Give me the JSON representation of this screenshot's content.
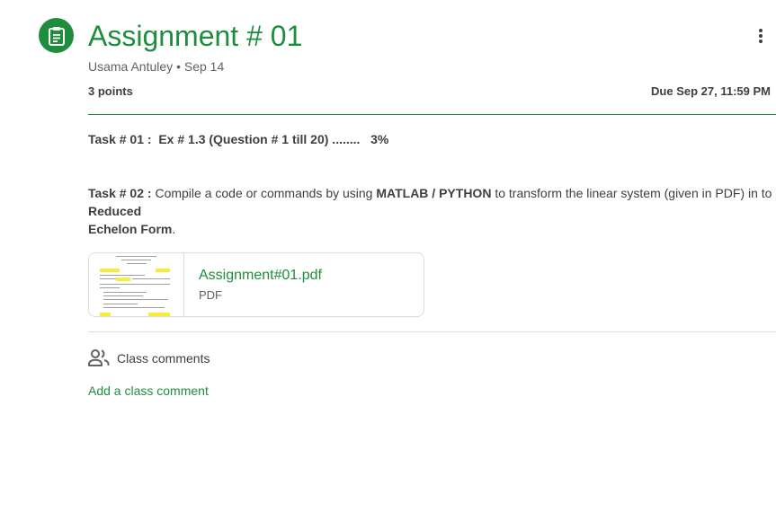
{
  "header": {
    "title": "Assignment # 01",
    "author": "Usama Antuley",
    "separator": "•",
    "date": "Sep 14",
    "points": "3 points",
    "due": "Due Sep 27, 11:59 PM",
    "icon": "assignment-icon",
    "more_icon": "more-vert-icon"
  },
  "description": {
    "task1": {
      "label": "Task # 01 :",
      "text": "Ex # 1.3 (Question # 1 till 20) ........",
      "weight": "3%"
    },
    "task2": {
      "label": "Task # 02 :",
      "text_a": "Compile a code or commands by using",
      "tool": "MATLAB / PYTHON",
      "text_b": "to transform the linear system (given in PDF) in to",
      "target_a": "Reduced",
      "target_b": "Echelon Form",
      "end": "."
    }
  },
  "attachment": {
    "name": "Assignment#01.pdf",
    "type": "PDF"
  },
  "comments": {
    "label": "Class comments",
    "add_label": "Add a class comment",
    "icon": "people-icon"
  },
  "colors": {
    "accent": "#1e8e3e",
    "text": "#3c4043",
    "muted": "#5f6368",
    "divider": "#dadce0"
  }
}
